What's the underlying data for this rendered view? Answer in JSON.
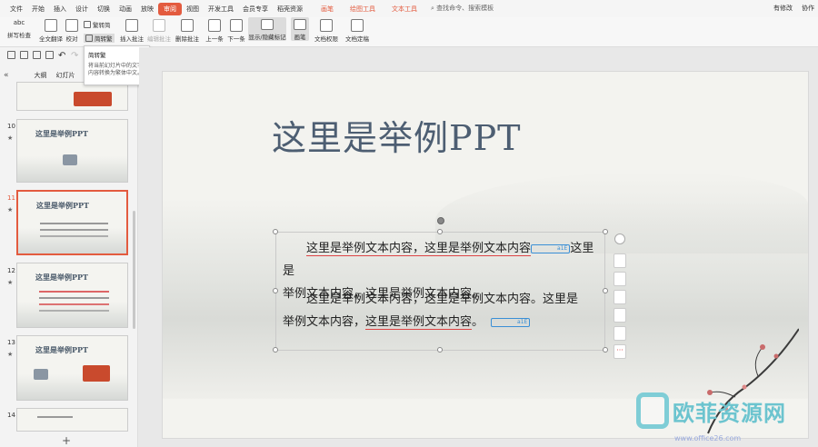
{
  "menu": {
    "items": [
      "文件",
      "开始",
      "插入",
      "设计",
      "切换",
      "动画",
      "放映",
      "审阅",
      "视图",
      "开发工具",
      "会员专享",
      "稻壳资源"
    ],
    "active_index": 7,
    "context_tabs": [
      "画笔",
      "绘图工具",
      "文本工具"
    ],
    "search": "查找命令、搜索模板",
    "right": [
      "有修改",
      "协作"
    ]
  },
  "toolbar": {
    "spell_check": "拼写检查",
    "translate": "全文翻译",
    "proofread": "校对",
    "to_traditional": "繁转简",
    "to_simplified": "简转繁",
    "insert_comment": "插入批注",
    "edit_comment": "编辑批注",
    "delete_comment": "删除批注",
    "prev": "上一条",
    "next": "下一条",
    "show_hide": "显示/隐藏标记",
    "pen": "画笔",
    "doc_permission": "文档权限",
    "doc_finalize": "文档定稿"
  },
  "tooltip": {
    "title": "简转繁",
    "desc_line1": "将当前幻灯片中的文字",
    "desc_line2": "内容转换为繁体中文。"
  },
  "panel": {
    "tab_outline": "大纲",
    "tab_slides": "幻灯片",
    "add": "+"
  },
  "thumbnails": [
    {
      "num": "10",
      "title": "这里是举例PPT"
    },
    {
      "num": "11",
      "title": "这里是举例PPT"
    },
    {
      "num": "12",
      "title": "这里是举例PPT"
    },
    {
      "num": "13",
      "title": "这里是举例PPT"
    },
    {
      "num": "14",
      "title": "这里是举例PPT"
    }
  ],
  "slide": {
    "title": "这里是举例PPT",
    "para1_a": "这里是举例文本内容，这里是举例文本内容",
    "para1_tag": "a1E",
    "para1_b": "这里是",
    "para1_line2": "举例文本内容，这里是举例文本内容。",
    "para2_line1": "这里是举例文本内容，这里是举例文本内容。这里是",
    "para2_line2_a": "举例文本内容，",
    "para2_line2_ul": "这里是举例文本内容",
    "para2_line2_b": "。",
    "para2_tag": "a1E"
  },
  "watermark": {
    "text": "欧菲资源网",
    "url": "www.office26.com"
  }
}
